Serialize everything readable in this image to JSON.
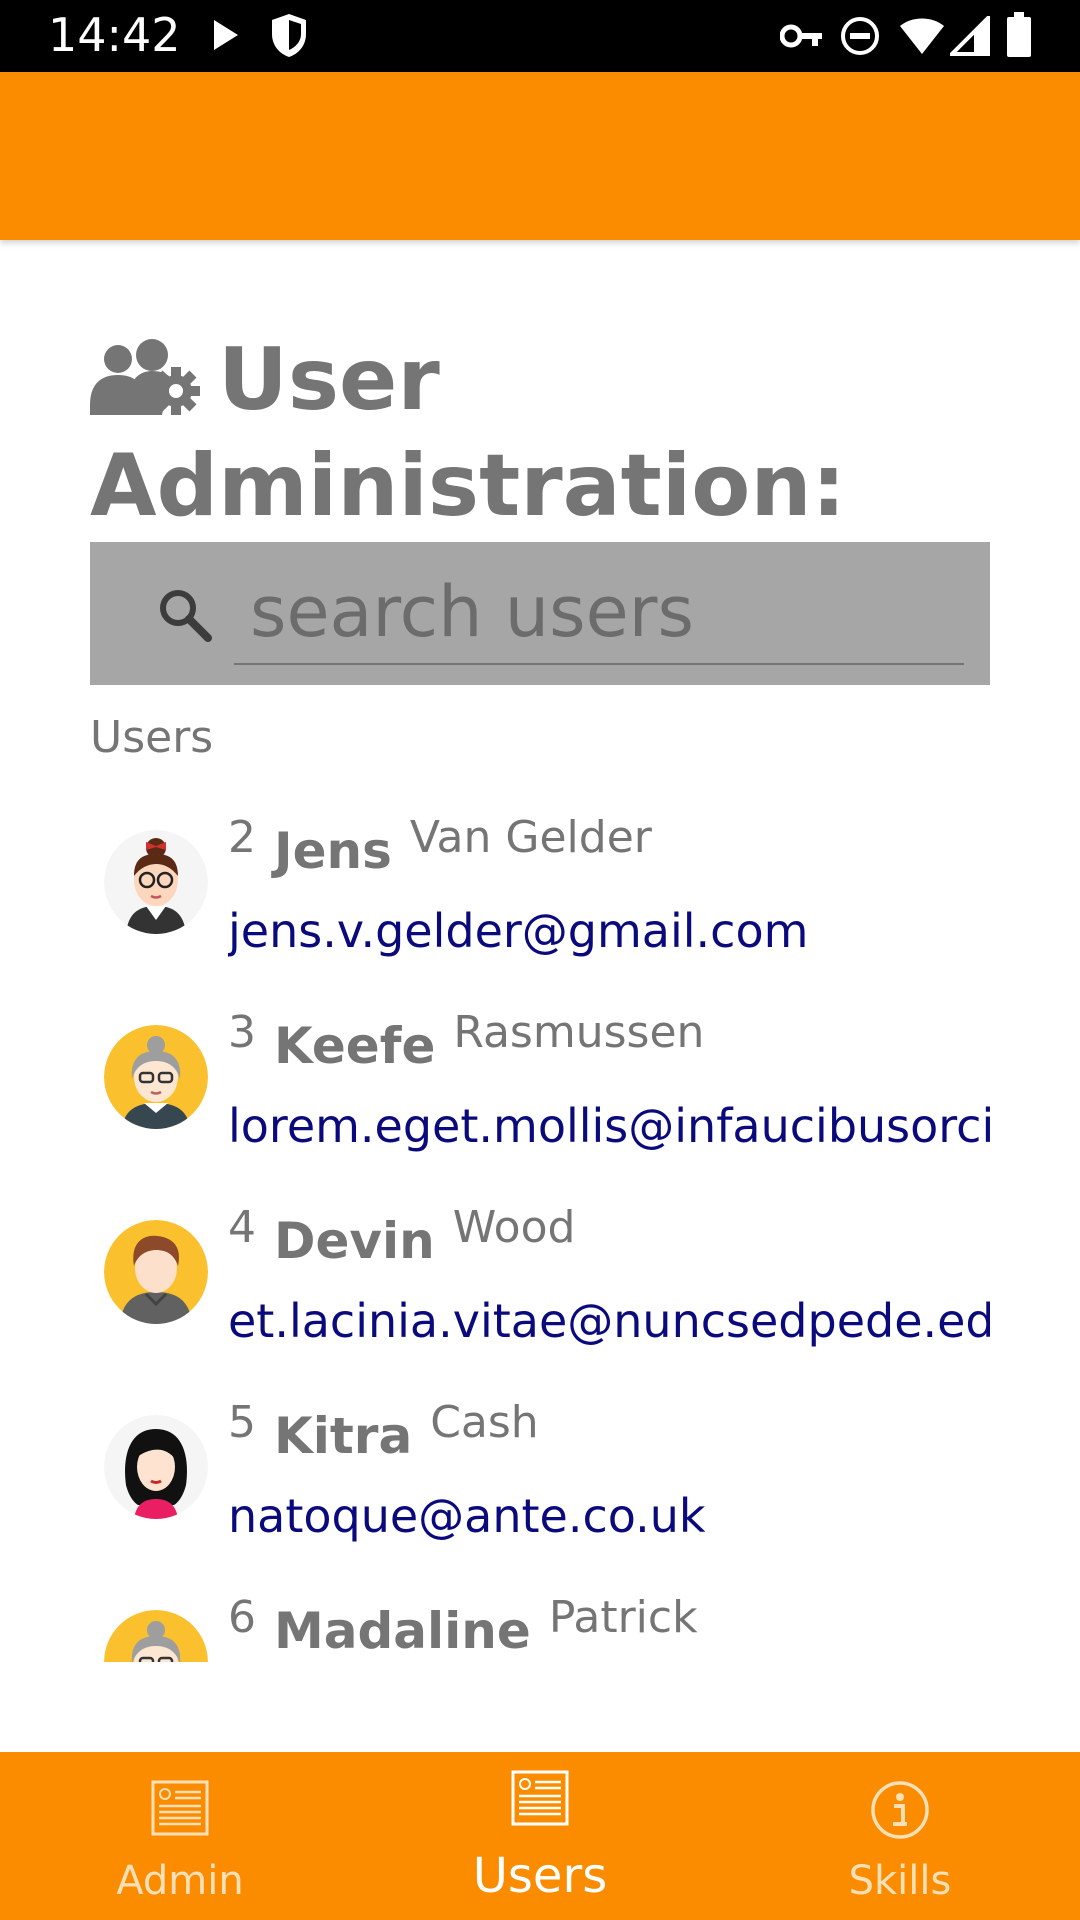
{
  "status_bar": {
    "time": "14:42",
    "icons": [
      "play-icon",
      "shield-icon",
      "vpn-key-icon",
      "do-not-disturb-icon",
      "wifi-icon",
      "signal-icon",
      "battery-icon"
    ]
  },
  "colors": {
    "accent": "#fb8c00",
    "title_gray": "#757575",
    "email_blue": "#0a0a7d",
    "search_bg": "#a6a6a6"
  },
  "page": {
    "title_line1": "User",
    "title_line2": "Administration:",
    "title_icon": "users-cog-icon"
  },
  "search": {
    "placeholder": "search users",
    "value": ""
  },
  "users_section_label": "Users",
  "users": [
    {
      "id": "2",
      "first": "Jens",
      "last": "Van Gelder",
      "email": "jens.v.gelder@gmail.com",
      "avatar": "woman-glasses-bun-avatar"
    },
    {
      "id": "3",
      "first": "Keefe",
      "last": "Rasmussen",
      "email": "lorem.eget.mollis@infaucibusorci.co",
      "avatar": "grandma-glasses-avatar"
    },
    {
      "id": "4",
      "first": "Devin",
      "last": "Wood",
      "email": "et.lacinia.vitae@nuncsedpede.edu",
      "avatar": "man-hoodie-avatar"
    },
    {
      "id": "5",
      "first": "Kitra",
      "last": "Cash",
      "email": "natoque@ante.co.uk",
      "avatar": "woman-black-hair-avatar"
    },
    {
      "id": "6",
      "first": "Madaline",
      "last": "Patrick",
      "email": "",
      "avatar": "grandma-glasses-avatar"
    }
  ],
  "bottom_nav": {
    "admin": "Admin",
    "users": "Users",
    "skills": "Skills",
    "active": "Users"
  }
}
